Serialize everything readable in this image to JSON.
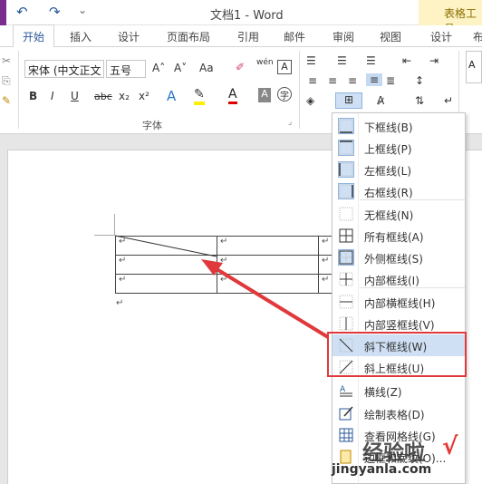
{
  "window": {
    "title": "文档1 - Word",
    "context_tab_group": "表格工具"
  },
  "quick_access": {
    "undo": "↶",
    "redo": "↷",
    "customize": "⌄"
  },
  "tabs": [
    {
      "label": "开始",
      "active": true
    },
    {
      "label": "插入"
    },
    {
      "label": "设计"
    },
    {
      "label": "页面布局"
    },
    {
      "label": "引用"
    },
    {
      "label": "邮件"
    },
    {
      "label": "审阅"
    },
    {
      "label": "视图"
    },
    {
      "label": "设计"
    },
    {
      "label": "布"
    }
  ],
  "ribbon": {
    "font_name": "宋体 (中文正文",
    "font_size": "五号",
    "grow_font": "A˄",
    "shrink_font": "A˅",
    "change_case": "Aa",
    "phonetic": "wén",
    "bold": "B",
    "italic": "I",
    "underline": "U",
    "strike": "abc",
    "subscript": "x₂",
    "superscript": "x²",
    "font_group_label": "字体",
    "styles_preview": "A"
  },
  "document": {
    "table_rows": [
      [
        "↵",
        "↵",
        "↵"
      ],
      [
        "↵",
        "↵",
        "↵"
      ],
      [
        "↵",
        "↵",
        "↵"
      ]
    ],
    "after_table_mark": "↵"
  },
  "border_menu": {
    "items": [
      {
        "label": "下框线(B)",
        "icon": "bottom-border-icon",
        "checked": true
      },
      {
        "label": "上框线(P)",
        "icon": "top-border-icon",
        "checked": true
      },
      {
        "label": "左框线(L)",
        "icon": "left-border-icon",
        "checked": true
      },
      {
        "label": "右框线(R)",
        "icon": "right-border-icon",
        "checked": true
      },
      {
        "label": "无框线(N)",
        "icon": "no-border-icon"
      },
      {
        "label": "所有框线(A)",
        "icon": "all-borders-icon"
      },
      {
        "label": "外侧框线(S)",
        "icon": "outside-borders-icon",
        "checked": true
      },
      {
        "label": "内部框线(I)",
        "icon": "inside-borders-icon"
      },
      {
        "label": "内部横框线(H)",
        "icon": "inside-horizontal-border-icon"
      },
      {
        "label": "内部竖框线(V)",
        "icon": "inside-vertical-border-icon"
      },
      {
        "label": "斜下框线(W)",
        "icon": "diagonal-down-border-icon",
        "highlighted": true
      },
      {
        "label": "斜上框线(U)",
        "icon": "diagonal-up-border-icon"
      },
      {
        "label": "横线(Z)",
        "icon": "horizontal-line-icon"
      },
      {
        "label": "绘制表格(D)",
        "icon": "draw-table-icon"
      },
      {
        "label": "查看网格线(G)",
        "icon": "view-gridlines-icon"
      },
      {
        "label": "边框和底纹(O)...",
        "icon": "borders-shading-icon"
      }
    ]
  },
  "watermark": {
    "text": "经验啦",
    "url": "jingyanla.com",
    "check": "√"
  },
  "colors": {
    "word_blue": "#2b579a",
    "accent_red": "#e0393c",
    "highlight": "#cfe0f4"
  }
}
